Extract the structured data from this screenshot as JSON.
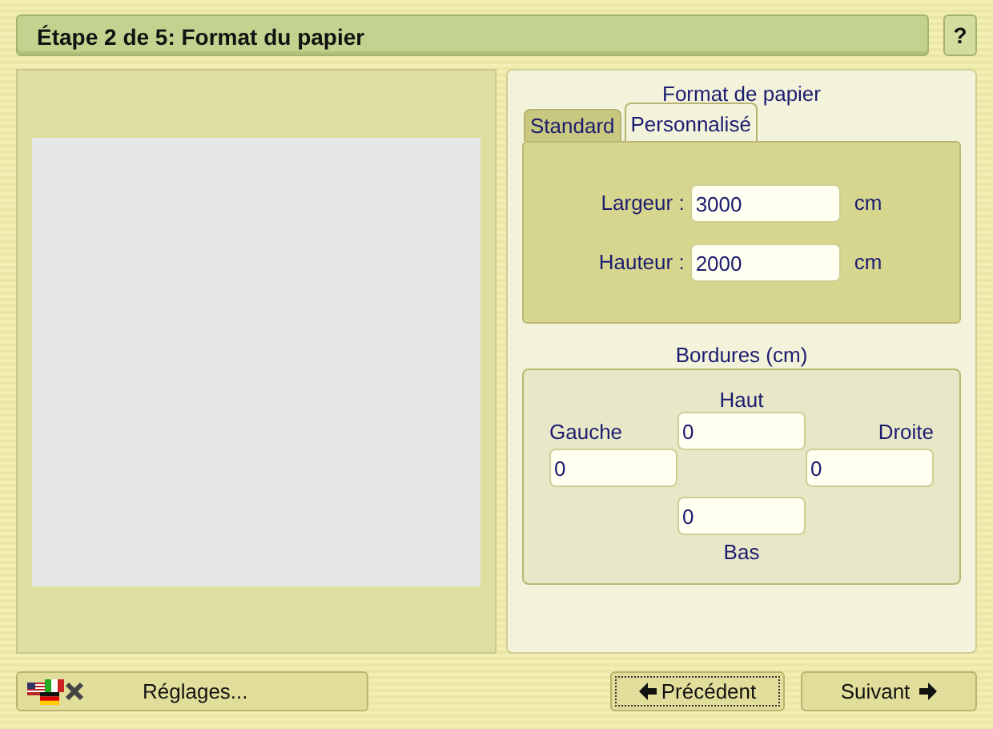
{
  "header": {
    "title": "Étape 2 de 5: Format du papier",
    "help": "?"
  },
  "paper_format": {
    "title": "Format de papier",
    "tabs": [
      {
        "label": "Standard",
        "selected": false
      },
      {
        "label": "Personnalisé",
        "selected": true
      }
    ],
    "fields": [
      {
        "label": "Largeur :",
        "value": "3000",
        "unit": "cm"
      },
      {
        "label": "Hauteur :",
        "value": "2000",
        "unit": "cm"
      }
    ]
  },
  "borders": {
    "title": "Bordures (cm)",
    "top": {
      "label": "Haut",
      "value": "0"
    },
    "left": {
      "label": "Gauche",
      "value": "0"
    },
    "right": {
      "label": "Droite",
      "value": "0"
    },
    "bottom": {
      "label": "Bas",
      "value": "0"
    }
  },
  "buttons": [
    {
      "label": "Réglages...",
      "kind": "settings",
      "focused": false
    },
    {
      "label": "Précédent",
      "kind": "back",
      "focused": true
    },
    {
      "label": "Suivant",
      "kind": "next",
      "focused": false
    }
  ]
}
